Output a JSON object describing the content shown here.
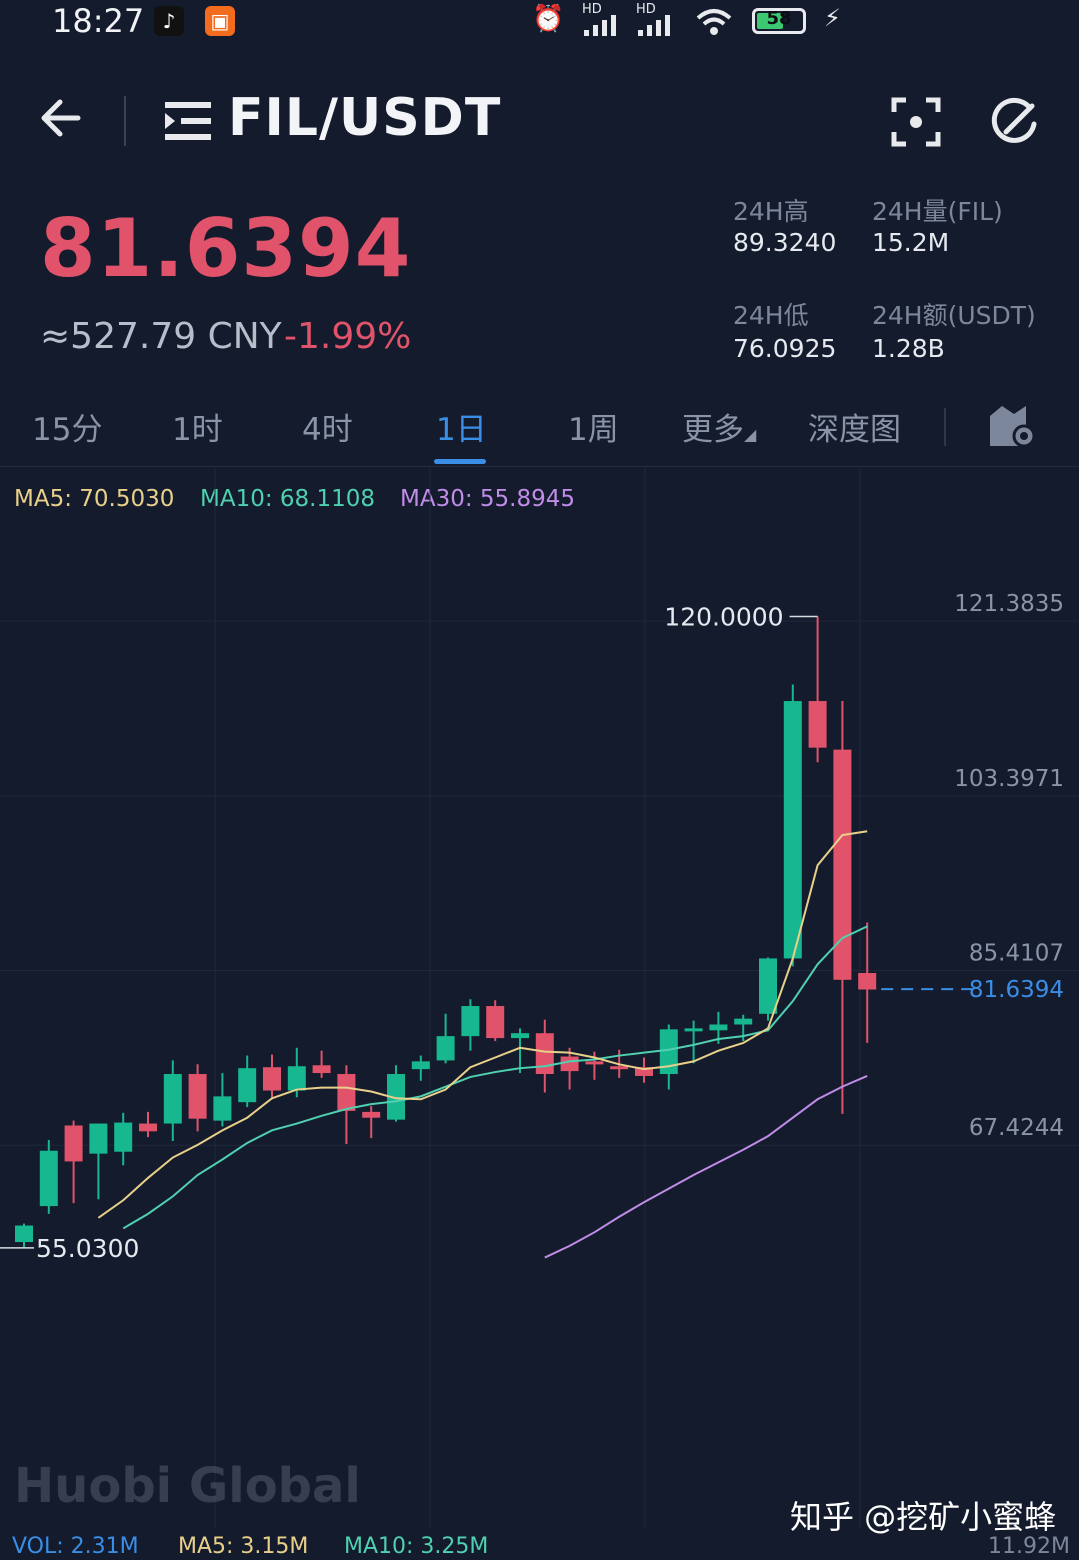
{
  "status_bar": {
    "time": "18:27",
    "battery": "58",
    "battery_level_pct": 58,
    "network_labels": [
      "HD",
      "HD"
    ]
  },
  "header": {
    "pair": "FIL/USDT"
  },
  "ticker": {
    "last_price": "81.6394",
    "cny_price": "≈527.79 CNY",
    "change_pct": "-1.99%",
    "stats": [
      {
        "label": "24H高",
        "value": "89.3240"
      },
      {
        "label": "24H量(FIL)",
        "value": "15.2M"
      },
      {
        "label": "24H低",
        "value": "76.0925"
      },
      {
        "label": "24H额(USDT)",
        "value": "1.28B"
      }
    ]
  },
  "tabs": [
    {
      "label": "15分",
      "active": false
    },
    {
      "label": "1时",
      "active": false
    },
    {
      "label": "4时",
      "active": false
    },
    {
      "label": "1日",
      "active": true
    },
    {
      "label": "1周",
      "active": false
    },
    {
      "label": "更多",
      "active": false
    },
    {
      "label": "深度图",
      "active": false
    }
  ],
  "indicators": {
    "ma5": "MA5: 70.5030",
    "ma10": "MA10: 68.1108",
    "ma30": "MA30: 55.8945"
  },
  "volume_indicators": {
    "vol": "VOL: 2.31M",
    "ma5": "MA5: 3.15M",
    "ma10": "MA10: 3.25M",
    "axis_top": "11.92M"
  },
  "watermark": "知乎 @挖矿小蜜蜂",
  "brand_watermark": "Huobi Global",
  "colors": {
    "up": "#17b890",
    "down": "#e0536a",
    "ma5": "#e9d08a",
    "ma10": "#4fd0b0",
    "ma30": "#c08ce8",
    "accent": "#3a8ee6"
  },
  "chart_data": {
    "type": "candlestick",
    "y_ticks": [
      121.3835,
      103.3971,
      85.4107,
      67.4244
    ],
    "ylim": [
      52.0,
      125.0
    ],
    "last_price": 81.6394,
    "max_label": "120.0000",
    "min_label": "55.0300",
    "candles": [
      {
        "o": 55.6,
        "h": 57.5,
        "l": 55.0,
        "c": 57.3
      },
      {
        "o": 59.3,
        "h": 66.1,
        "l": 58.5,
        "c": 65.0
      },
      {
        "o": 67.6,
        "h": 68.1,
        "l": 59.6,
        "c": 63.9
      },
      {
        "o": 64.7,
        "h": 65.8,
        "l": 60.0,
        "c": 67.8
      },
      {
        "o": 64.9,
        "h": 68.9,
        "l": 63.5,
        "c": 67.9
      },
      {
        "o": 67.8,
        "h": 69.0,
        "l": 66.4,
        "c": 67.0
      },
      {
        "o": 67.8,
        "h": 74.3,
        "l": 66.0,
        "c": 72.9
      },
      {
        "o": 72.9,
        "h": 73.9,
        "l": 67.0,
        "c": 68.3
      },
      {
        "o": 68.1,
        "h": 73.0,
        "l": 67.5,
        "c": 70.6
      },
      {
        "o": 70.0,
        "h": 74.8,
        "l": 69.5,
        "c": 73.5
      },
      {
        "o": 73.6,
        "h": 74.9,
        "l": 70.3,
        "c": 71.2
      },
      {
        "o": 71.2,
        "h": 75.6,
        "l": 70.5,
        "c": 73.7
      },
      {
        "o": 73.8,
        "h": 75.3,
        "l": 72.5,
        "c": 73.0
      },
      {
        "o": 72.9,
        "h": 73.8,
        "l": 65.7,
        "c": 69.1
      },
      {
        "o": 69.0,
        "h": 69.6,
        "l": 66.3,
        "c": 68.4
      },
      {
        "o": 68.2,
        "h": 73.8,
        "l": 68.0,
        "c": 72.9
      },
      {
        "o": 73.4,
        "h": 74.8,
        "l": 72.2,
        "c": 74.2
      },
      {
        "o": 74.3,
        "h": 79.1,
        "l": 74.0,
        "c": 76.8
      },
      {
        "o": 76.8,
        "h": 80.6,
        "l": 75.3,
        "c": 79.9
      },
      {
        "o": 79.9,
        "h": 80.5,
        "l": 76.3,
        "c": 76.6
      },
      {
        "o": 76.6,
        "h": 77.6,
        "l": 73.0,
        "c": 77.1
      },
      {
        "o": 77.1,
        "h": 78.5,
        "l": 71.0,
        "c": 72.9
      },
      {
        "o": 74.7,
        "h": 75.6,
        "l": 71.3,
        "c": 73.2
      },
      {
        "o": 74.2,
        "h": 75.2,
        "l": 72.3,
        "c": 73.9
      },
      {
        "o": 73.7,
        "h": 75.4,
        "l": 72.5,
        "c": 73.6
      },
      {
        "o": 73.6,
        "h": 74.6,
        "l": 72.0,
        "c": 72.7
      },
      {
        "o": 72.9,
        "h": 78.0,
        "l": 71.3,
        "c": 77.5
      },
      {
        "o": 77.5,
        "h": 78.4,
        "l": 74.0,
        "c": 77.6
      },
      {
        "o": 77.4,
        "h": 79.3,
        "l": 76.0,
        "c": 78.0
      },
      {
        "o": 78.0,
        "h": 79.0,
        "l": 76.3,
        "c": 78.6
      },
      {
        "o": 79.1,
        "h": 84.9,
        "l": 78.4,
        "c": 84.8
      },
      {
        "o": 84.8,
        "h": 113.0,
        "l": 84.0,
        "c": 111.3
      },
      {
        "o": 111.3,
        "h": 120.0,
        "l": 105.0,
        "c": 106.5
      },
      {
        "o": 106.3,
        "h": 111.3,
        "l": 68.8,
        "c": 82.6
      },
      {
        "o": 83.3,
        "h": 88.5,
        "l": 76.1,
        "c": 81.6
      }
    ],
    "ma5": [
      null,
      null,
      null,
      58.1,
      59.9,
      62.2,
      64.3,
      65.6,
      67.1,
      68.4,
      70.4,
      71.3,
      71.5,
      71.5,
      71.1,
      70.4,
      70.3,
      71.3,
      73.6,
      74.6,
      75.6,
      75.2,
      75.1,
      74.6,
      73.9,
      73.4,
      73.7,
      74.2,
      75.3,
      76.1,
      77.6,
      84.8,
      94.4,
      97.5,
      97.9
    ],
    "ma10": [
      null,
      null,
      null,
      null,
      57.0,
      58.5,
      60.3,
      62.5,
      64.1,
      65.8,
      67.1,
      67.8,
      68.6,
      69.3,
      69.8,
      70.1,
      70.6,
      71.6,
      72.6,
      73.1,
      73.5,
      73.7,
      74.2,
      74.4,
      74.8,
      75.1,
      75.4,
      75.9,
      76.5,
      76.8,
      77.4,
      80.4,
      84.2,
      86.9,
      88.1
    ],
    "ma30": [
      null,
      null,
      null,
      null,
      null,
      null,
      null,
      null,
      null,
      null,
      null,
      null,
      null,
      null,
      null,
      null,
      null,
      null,
      null,
      null,
      null,
      54.0,
      55.2,
      56.6,
      58.2,
      59.7,
      61.1,
      62.5,
      63.8,
      65.1,
      66.5,
      68.4,
      70.3,
      71.6,
      72.7
    ]
  }
}
